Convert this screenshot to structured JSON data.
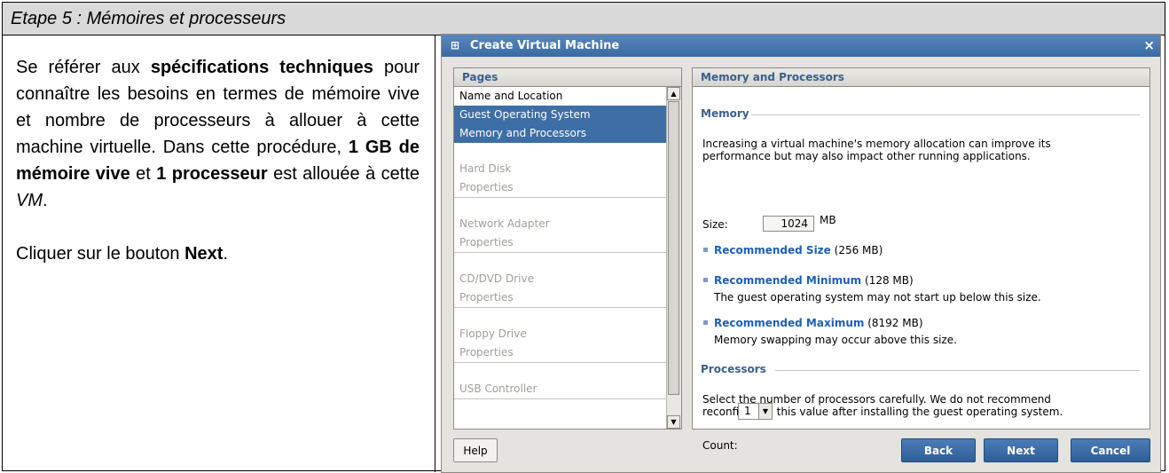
{
  "doc": {
    "header": "Etape 5 : Mémoires et processeurs",
    "p1": {
      "a": "Se référer aux ",
      "b": "spécifications techniques",
      "c": " pour connaître les besoins en termes de mémoire vive et nombre de processeurs à allouer à cette machine virtuelle. Dans cette procédure, ",
      "d": "1 GB de mémoire vive",
      "e": " et ",
      "f": "1 processeur",
      "g": " est allouée à cette ",
      "h": "VM",
      "i": "."
    },
    "p2": {
      "a": "Cliquer sur le bouton ",
      "b": "Next",
      "c": "."
    }
  },
  "dialog": {
    "title": "Create Virtual Machine",
    "close": "×",
    "pages_header": "Pages",
    "pages": [
      "Name and Location",
      "Guest Operating System",
      "Memory and Processors",
      "Hard Disk",
      "Properties",
      "Network Adapter",
      "Properties",
      "CD/DVD Drive",
      "Properties",
      "Floppy Drive",
      "Properties",
      "USB Controller"
    ],
    "content_header": "Memory and Processors",
    "memory": {
      "title": "Memory",
      "desc1": "Increasing a virtual machine's memory allocation can improve its",
      "desc2": "performance but may also impact other running applications.",
      "size_label": "Size:",
      "size_value": "1024",
      "size_unit": "MB",
      "rec_size": "Recommended Size",
      "rec_size_val": "(256 MB)",
      "rec_min": "Recommended Minimum",
      "rec_min_val": "(128 MB)",
      "rec_min_note": "The guest operating system may not start up below this size.",
      "rec_max": "Recommended Maximum",
      "rec_max_val": "(8192 MB)",
      "rec_max_note": "Memory swapping may occur above this size."
    },
    "processors": {
      "title": "Processors",
      "desc1": "Select the number of processors carefully. We do not recommend",
      "desc2": "reconfiguring this value after installing the guest operating system.",
      "count_label": "Count:",
      "count_value": "1"
    },
    "buttons": {
      "help": "Help",
      "back": "Back",
      "next": "Next",
      "cancel": "Cancel"
    },
    "icons": {
      "title": "vm-icon",
      "scroll_up": "scroll-up-arrow",
      "scroll_down": "scroll-down-arrow",
      "dropdown": "dropdown-arrow"
    }
  }
}
